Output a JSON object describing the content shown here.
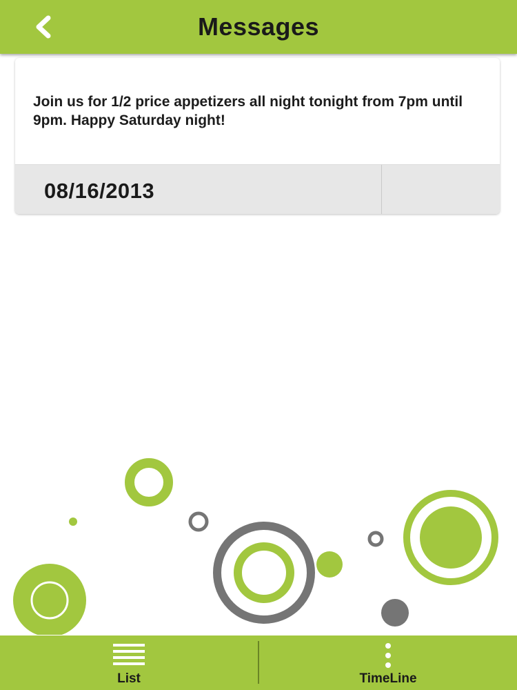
{
  "header": {
    "title": "Messages",
    "back_icon": "chevron-left-icon"
  },
  "message": {
    "body": "Join us for 1/2 price appetizers all night tonight from 7pm until 9pm. Happy Saturday night!",
    "date": "08/16/2013"
  },
  "tabs": [
    {
      "label": "List",
      "icon": "list-icon"
    },
    {
      "label": "TimeLine",
      "icon": "vertical-dots-icon"
    }
  ],
  "colors": {
    "accent": "#a2c73f",
    "decor_gray": "#757575",
    "card_footer": "#e7e7e7"
  }
}
